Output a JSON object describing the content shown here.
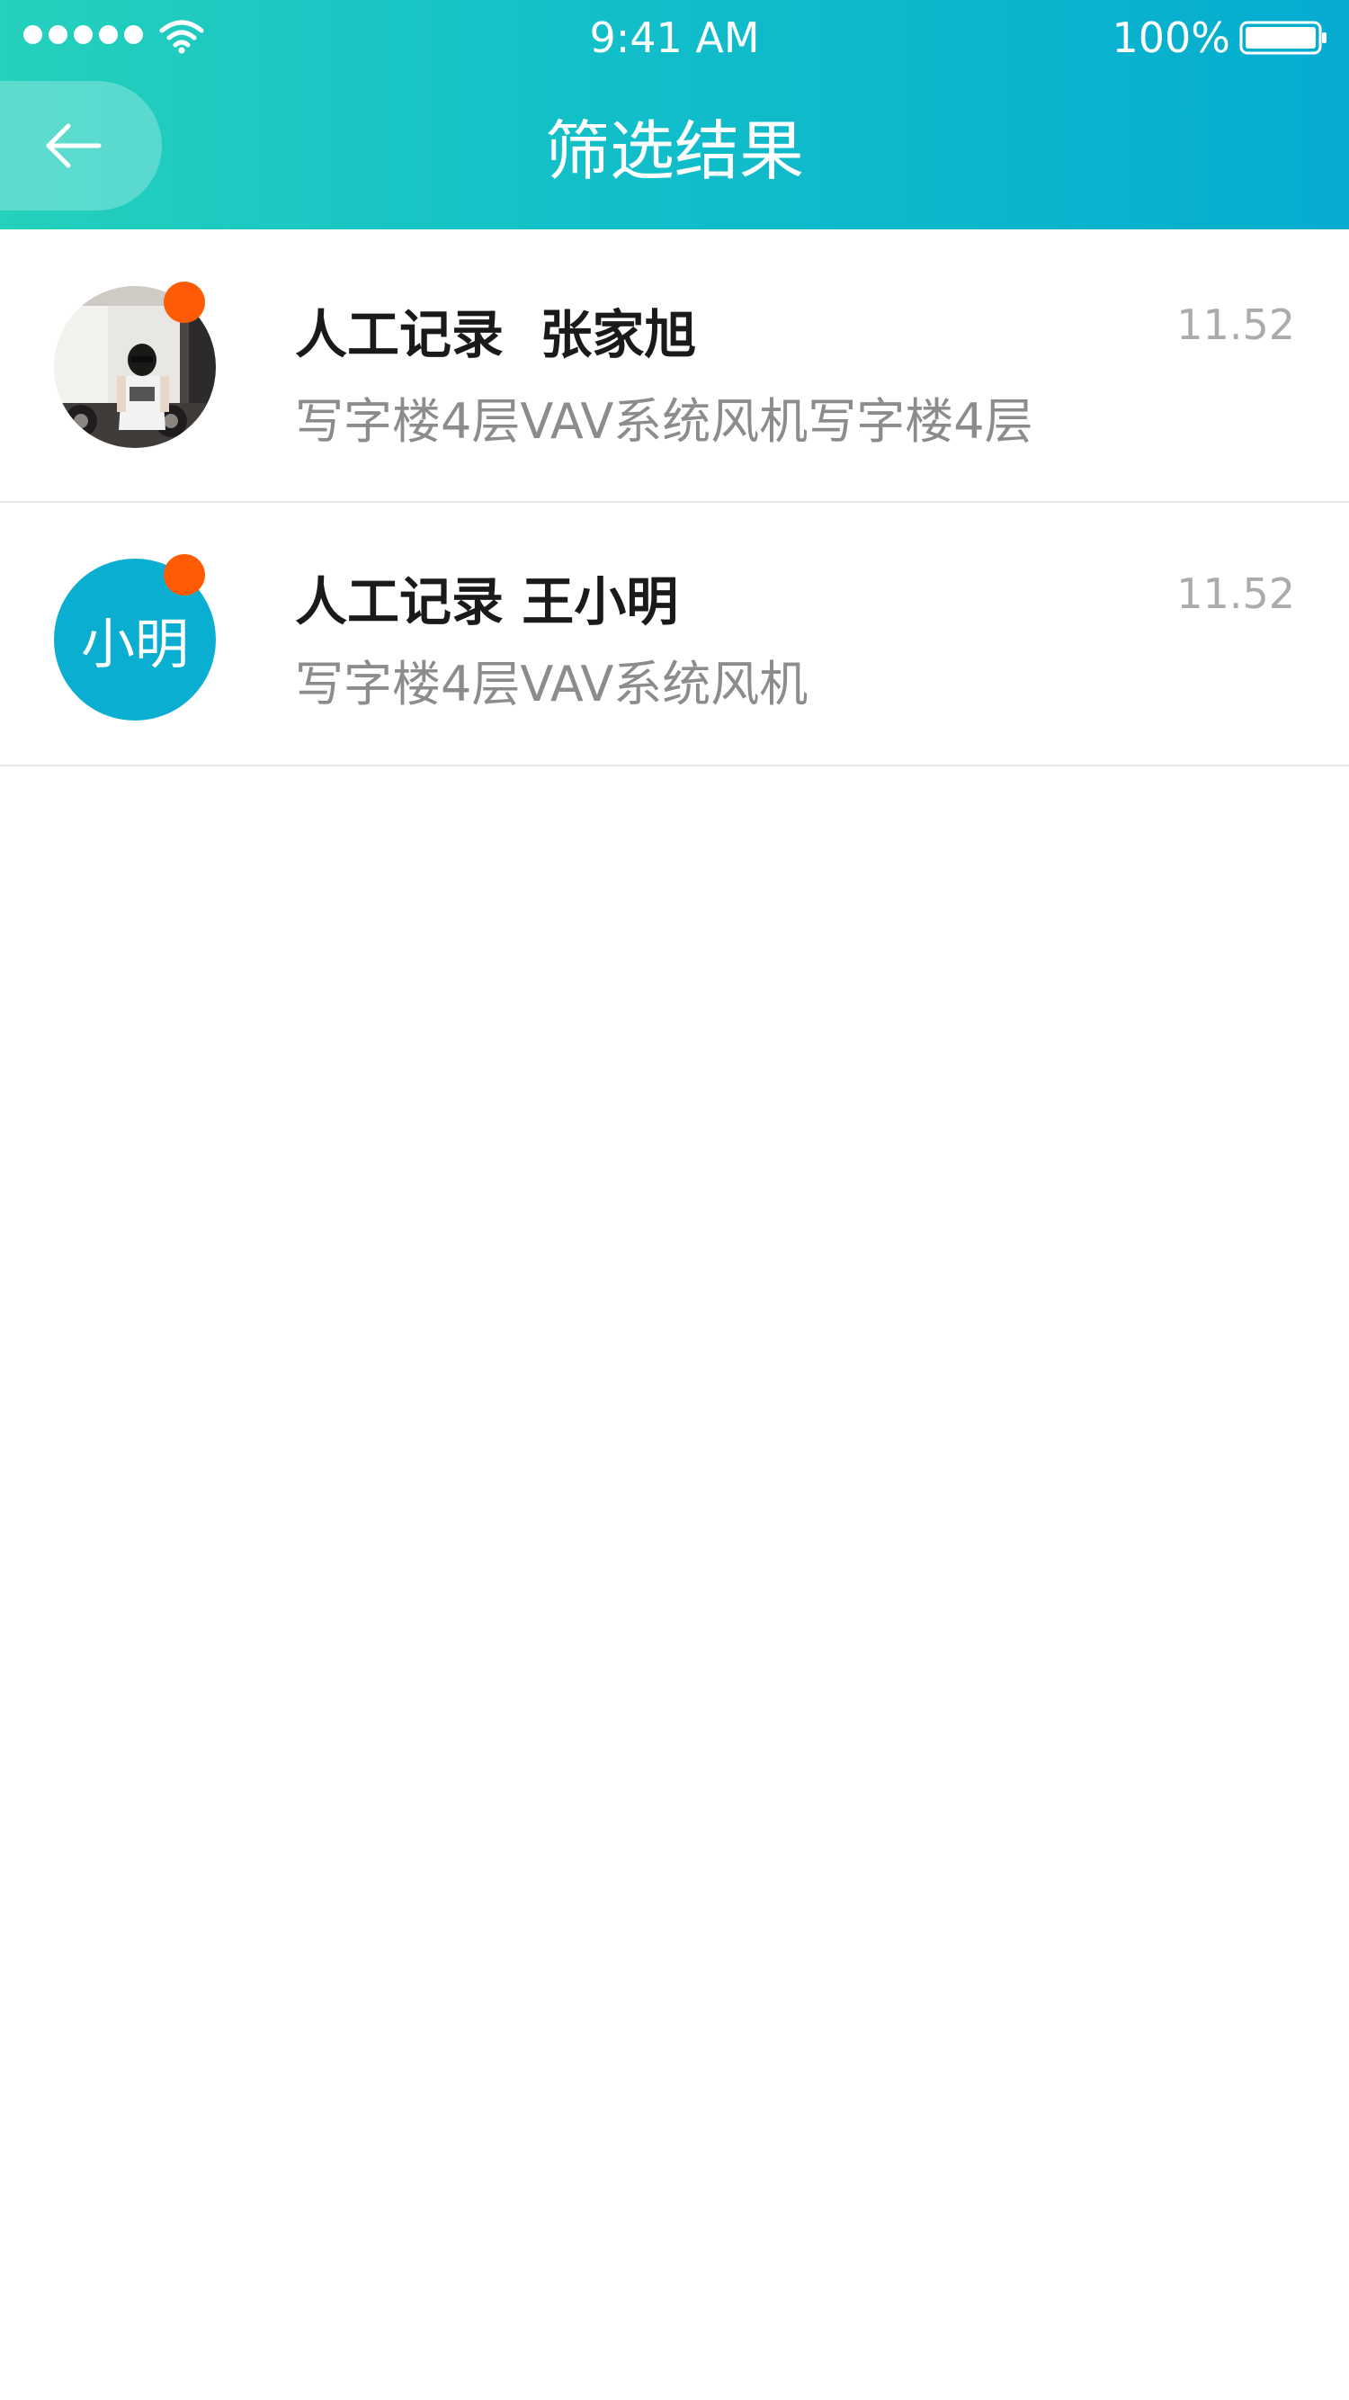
{
  "status_bar": {
    "time": "9:41 AM",
    "battery": "100%",
    "signal_icon": "signal-dots-icon",
    "wifi_icon": "wifi-icon",
    "battery_icon": "battery-icon"
  },
  "nav": {
    "title": "筛选结果",
    "back_icon": "arrow-left-icon"
  },
  "colors": {
    "header_gradient_start": "#25d0bc",
    "header_gradient_end": "#05acd0",
    "unread_dot": "#ff5b05",
    "avatar_bg": "#0aaed0"
  },
  "results": [
    {
      "title": "人工记录  张家旭",
      "subtitle": "写字楼4层VAV系统风机写字楼4层",
      "time": "11.52",
      "avatar_type": "photo",
      "unread": true
    },
    {
      "title": "人工记录 王小明",
      "subtitle": "写字楼4层VAV系统风机",
      "time": "11.52",
      "avatar_type": "initials",
      "avatar_text": "小明",
      "unread": true
    }
  ]
}
